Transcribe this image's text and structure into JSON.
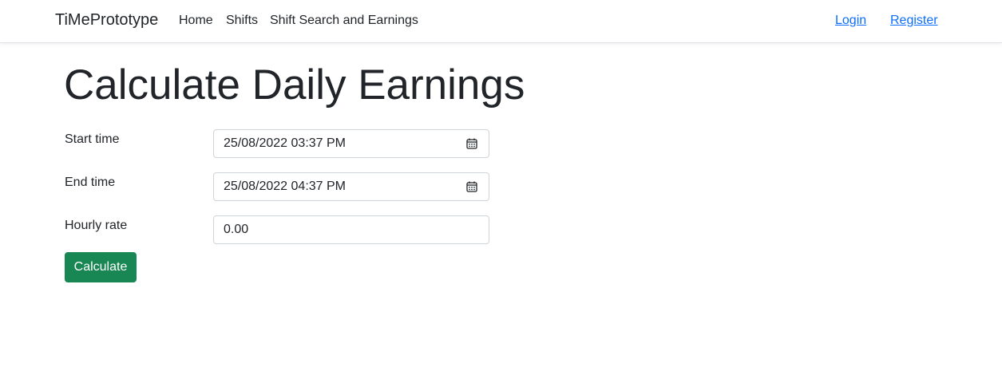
{
  "nav": {
    "brand": "TiMePrototype",
    "links": [
      "Home",
      "Shifts",
      "Shift Search and Earnings"
    ],
    "login": "Login",
    "register": "Register"
  },
  "page": {
    "title": "Calculate Daily Earnings"
  },
  "form": {
    "start_time": {
      "label": "Start time",
      "value": "25/08/2022 03:37  PM",
      "icon": "calendar-icon"
    },
    "end_time": {
      "label": "End time",
      "value": "25/08/2022 04:37  PM",
      "icon": "calendar-icon"
    },
    "hourly_rate": {
      "label": "Hourly rate",
      "value": "0.00"
    },
    "submit_label": "Calculate"
  },
  "colors": {
    "primary_link": "#0d6efd",
    "success_button": "#198754",
    "border": "#ced4da"
  }
}
